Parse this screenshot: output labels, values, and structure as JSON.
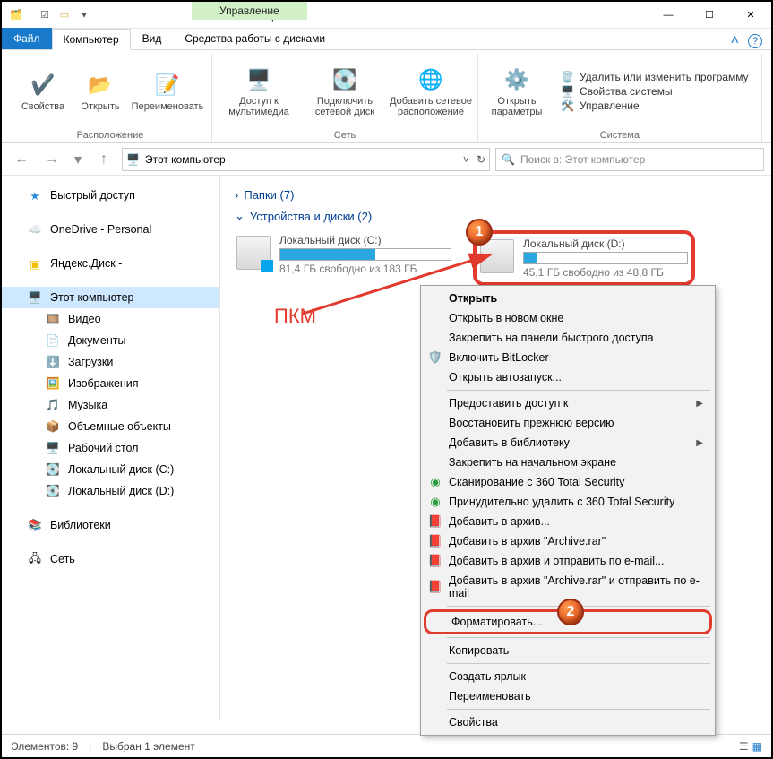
{
  "window": {
    "title": "Этот компьютер",
    "contextual_header": "Управление",
    "tabs": {
      "file": "Файл",
      "computer": "Компьютер",
      "view": "Вид",
      "drive_tools": "Средства работы с дисками"
    }
  },
  "ribbon": {
    "location": {
      "properties": "Свойства",
      "open": "Открыть",
      "rename": "Переименовать",
      "group": "Расположение"
    },
    "network": {
      "media": "Доступ к мультимедиа",
      "map": "Подключить сетевой диск",
      "add": "Добавить сетевое расположение",
      "group": "Сеть"
    },
    "system": {
      "settings": "Открыть параметры",
      "uninstall": "Удалить или изменить программу",
      "sysprops": "Свойства системы",
      "manage": "Управление",
      "group": "Система"
    }
  },
  "address": {
    "path": "Этот компьютер",
    "search_placeholder": "Поиск в: Этот компьютер"
  },
  "nav": {
    "quick": "Быстрый доступ",
    "onedrive": "OneDrive - Personal",
    "yandex": "Яндекс.Диск -",
    "thispc": "Этот компьютер",
    "videos": "Видео",
    "documents": "Документы",
    "downloads": "Загрузки",
    "pictures": "Изображения",
    "music": "Музыка",
    "objects3d": "Объемные объекты",
    "desktop": "Рабочий стол",
    "diskc": "Локальный диск (C:)",
    "diskd": "Локальный диск (D:)",
    "libraries": "Библиотеки",
    "network_nav": "Сеть"
  },
  "content": {
    "folders_header": "Папки (7)",
    "drives_header": "Устройства и диски (2)",
    "drive_c": {
      "name": "Локальный диск (C:)",
      "free": "81,4 ГБ свободно из 183 ГБ",
      "fill_pct": 56
    },
    "drive_d": {
      "name": "Локальный диск (D:)",
      "free": "45,1 ГБ свободно из 48,8 ГБ",
      "fill_pct": 8
    }
  },
  "context_menu": {
    "open": "Открыть",
    "open_new": "Открыть в новом окне",
    "pin_quick": "Закрепить на панели быстрого доступа",
    "bitlocker": "Включить BitLocker",
    "autoplay": "Открыть автозапуск...",
    "share": "Предоставить доступ к",
    "restore": "Восстановить прежнюю версию",
    "library": "Добавить в библиотеку",
    "pin_start": "Закрепить на начальном экране",
    "scan360": "Сканирование с 360 Total Security",
    "delete360": "Принудительно удалить с  360 Total Security",
    "archive": "Добавить в архив...",
    "archive_rar": "Добавить в архив \"Archive.rar\"",
    "archive_mail": "Добавить в архив и отправить по e-mail...",
    "archive_rar_mail": "Добавить в архив \"Archive.rar\" и отправить по e-mail",
    "format": "Форматировать...",
    "copy": "Копировать",
    "shortcut": "Создать ярлык",
    "rename": "Переименовать",
    "properties": "Свойства"
  },
  "status": {
    "count": "Элементов: 9",
    "selected": "Выбран 1 элемент"
  },
  "annotation": {
    "rmb": "ПКМ",
    "marker1": "1",
    "marker2": "2"
  }
}
